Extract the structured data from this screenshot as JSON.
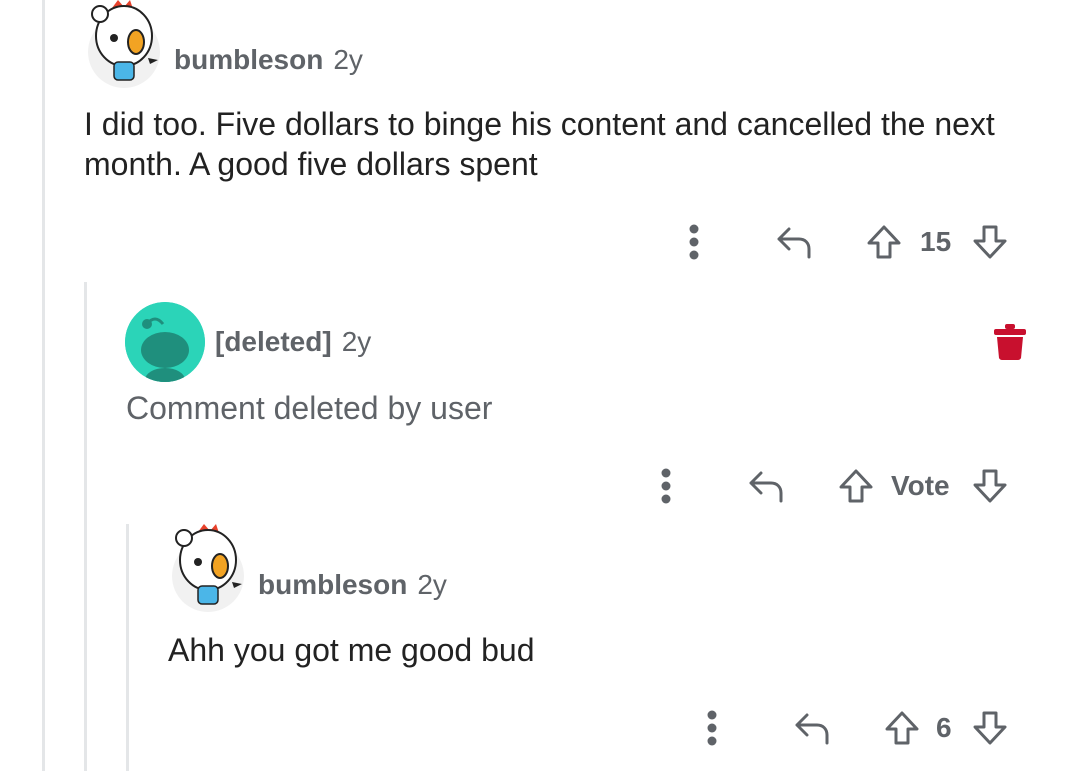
{
  "comments": [
    {
      "username": "bumbleson",
      "age": "2y",
      "body": "I did too. Five dollars to binge his content and cancelled the next month. A good five dollars spent",
      "score": "15"
    },
    {
      "username": "[deleted]",
      "age": "2y",
      "body": "Comment deleted by user",
      "score": "Vote"
    },
    {
      "username": "bumbleson",
      "age": "2y",
      "body": "Ahh you got me good bud",
      "score": "6"
    }
  ],
  "colors": {
    "thread_line": "#e4e6e8",
    "icon_gray": "#5f6368",
    "deleted_avatar": "#2bd4b8",
    "trash_red": "#c8102e",
    "chicken_red": "#e8412b"
  }
}
